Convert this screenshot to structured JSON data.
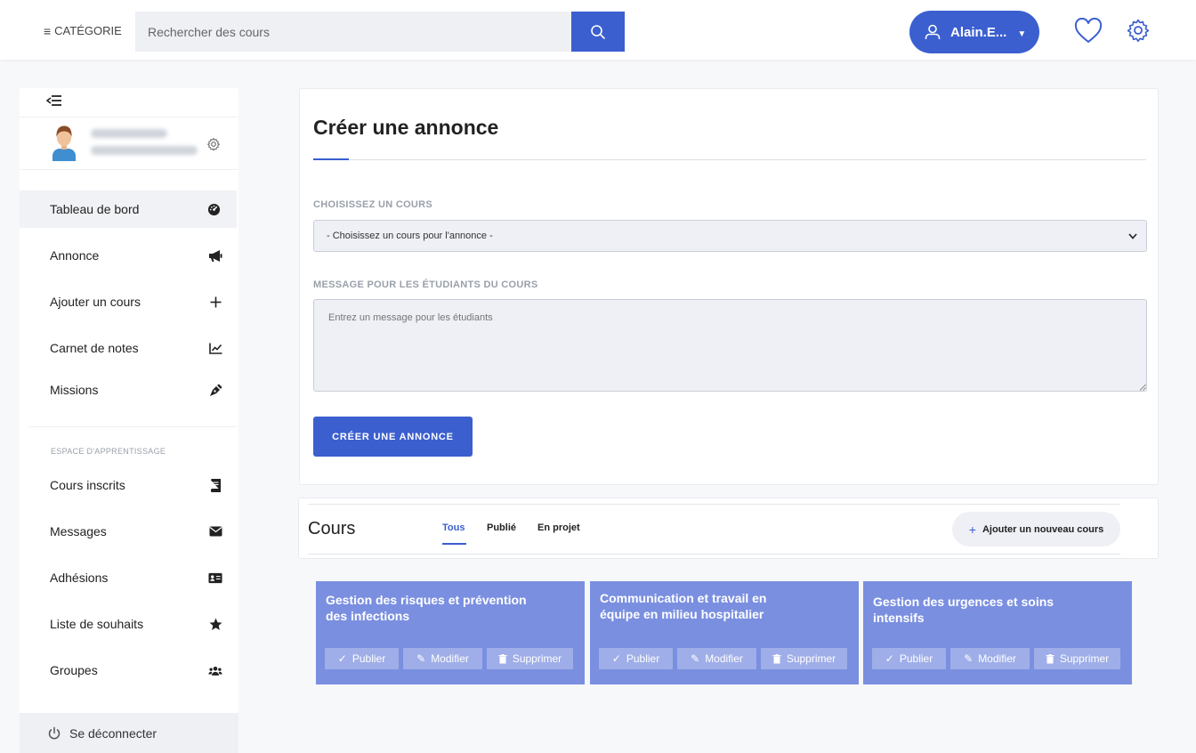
{
  "topbar": {
    "category_label": "CATÉGORIE",
    "search_placeholder": "Rechercher des cours",
    "user_name": "Alain.E..."
  },
  "sidebar": {
    "nav_items": [
      {
        "label": "Tableau de bord",
        "icon": "dashboard-icon",
        "active": true
      },
      {
        "label": "Annonce",
        "icon": "megaphone-icon"
      },
      {
        "label": "Ajouter un cours",
        "icon": "plus-icon"
      },
      {
        "label": "Carnet de notes",
        "icon": "chart-line-icon"
      },
      {
        "label": "Missions",
        "icon": "pen-nib-icon"
      }
    ],
    "section_label": "ESPACE D'APPRENTISSAGE",
    "learning_items": [
      {
        "label": "Cours inscrits",
        "icon": "book-icon"
      },
      {
        "label": "Messages",
        "icon": "envelope-icon"
      },
      {
        "label": "Adhésions",
        "icon": "id-card-icon"
      },
      {
        "label": "Liste de souhaits",
        "icon": "star-icon"
      },
      {
        "label": "Groupes",
        "icon": "users-icon"
      }
    ],
    "logout_label": "Se déconnecter"
  },
  "announcement": {
    "title": "Créer une annonce",
    "course_label": "CHOISISSEZ UN COURS",
    "course_select_value": "- Choisissez un cours pour l'annonce -",
    "message_label": "MESSAGE POUR LES ÉTUDIANTS DU COURS",
    "message_placeholder": "Entrez un message pour les étudiants",
    "submit_label": "CRÉER UNE ANNONCE"
  },
  "courses": {
    "title": "Cours",
    "tabs": [
      {
        "label": "Tous",
        "active": true
      },
      {
        "label": "Publié"
      },
      {
        "label": "En projet"
      }
    ],
    "add_label": "Ajouter un nouveau cours",
    "publish_label": "Publier",
    "edit_label": "Modifier",
    "delete_label": "Supprimer",
    "items": [
      {
        "title": "Gestion des risques et prévention des infections"
      },
      {
        "title": "Communication et travail en équipe en milieu hospitalier"
      },
      {
        "title": "Gestion des urgences et soins intensifs"
      }
    ]
  },
  "colors": {
    "primary": "#3b5fcf",
    "tile": "#7a8fe0"
  }
}
